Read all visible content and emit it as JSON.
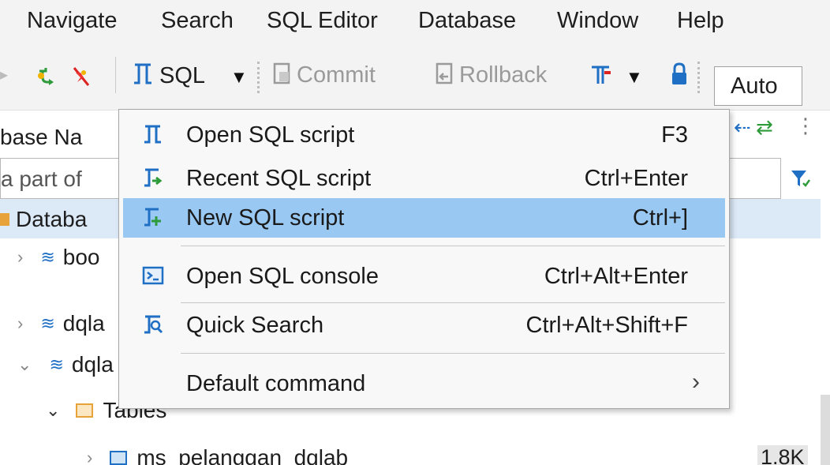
{
  "menubar": {
    "items": [
      "Navigate",
      "Search",
      "SQL Editor",
      "Database",
      "Window",
      "Help"
    ]
  },
  "toolbar": {
    "sql_label": "SQL",
    "commit_label": "Commit",
    "rollback_label": "Rollback",
    "transaction_mode": "Auto",
    "icons": [
      "connect-icon",
      "disconnect-icon",
      "sql-editor-icon",
      "dropdown-arrow-icon",
      "commit-icon",
      "rollback-icon",
      "transaction-log-icon",
      "lock-icon"
    ]
  },
  "navigator": {
    "tab_label": "base Na",
    "filter_placeholder": "a part of",
    "tree": [
      {
        "label": "Databa"
      },
      {
        "label": "boo"
      },
      {
        "label": "dqla"
      },
      {
        "label": "dqla"
      },
      {
        "label": "Tables"
      },
      {
        "label": "ms_pelanggan_dqlab",
        "size": "1.8K"
      }
    ]
  },
  "sql_menu": {
    "items": [
      {
        "label": "Open SQL script",
        "accelerator": "F3",
        "icon": "open-script-icon"
      },
      {
        "label": "Recent SQL script",
        "accelerator": "Ctrl+Enter",
        "icon": "recent-script-icon"
      },
      {
        "label": "New SQL script",
        "accelerator": "Ctrl+]",
        "icon": "new-script-icon",
        "highlighted": true
      },
      {
        "label": "Open SQL console",
        "accelerator": "Ctrl+Alt+Enter",
        "icon": "console-icon"
      },
      {
        "label": "Quick Search",
        "accelerator": "Ctrl+Alt+Shift+F",
        "icon": "quick-search-icon"
      },
      {
        "label": "Default command",
        "accelerator": "",
        "icon": "",
        "submenu": true
      }
    ]
  },
  "colors": {
    "highlight": "#99c9f3",
    "tree_selection": "#dce9f7",
    "icon_blue": "#1f6fc4",
    "folder_orange": "#e8a23a"
  }
}
